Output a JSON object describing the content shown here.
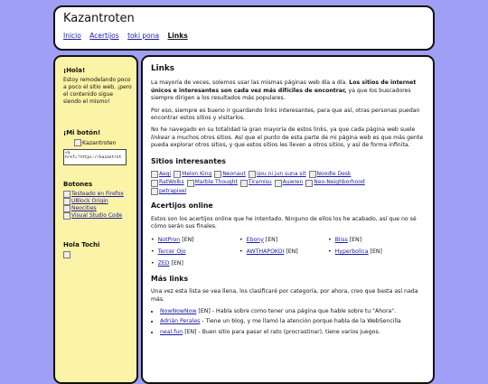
{
  "header": {
    "site_title": "Kazantroten",
    "nav": [
      "Inicio",
      "Acertijos",
      "toki pona",
      "Links"
    ]
  },
  "sidebar": {
    "hola": {
      "title": "¡Hola!",
      "text": "Estoy remodelando poco a poco el sitio web, ¡pero el contenido sigue siendo el mismo!"
    },
    "mi_boton": {
      "title": "¡Mi botón!",
      "img_alt": "Kazantroten",
      "code": "<a\nhref=\"https://kazantrot"
    },
    "botones": {
      "title": "Botones",
      "items": [
        "Testeado en Firefox",
        "UBlock Origin",
        "Neocities",
        "Visual Studio Code"
      ]
    },
    "hola_tochi": {
      "title": "Hola Tochi"
    }
  },
  "main": {
    "title": "Links",
    "intro": [
      "La mayoría de veces, solemos usar las mismas páginas web día a día. ",
      "Los sitios de internet únicos e interesantes son cada vez más difíciles de encontrar,",
      " ya que los buscadores siempre dirigen a los resultados más populares."
    ],
    "p2": "Por eso, siempre es bueno ir guardando links interesantes, para que así, otras personas puedan encontrar estos sitios y visitarlos.",
    "p3_a": "No he navegado en su totalidad la gran mayoría de estos links, ya que cada página web suele ",
    "p3_em": "linkear",
    "p3_b": " a muchos otros sitios. Así que el punto de esta parte de mi página web es que más gente pueda explorar otros sitios, y que estos sitios les lleven a otros sitios, y así de forma infinita.",
    "sitios": {
      "title": "Sitios interesantes",
      "items": [
        "Aegi",
        "Melon King",
        "Neonaut",
        "ijou ni jun suna sit",
        "Noodle Desk",
        "RatWolks",
        "Marble Thought",
        "Tiramisu",
        "Auwren",
        "Neo-Neighborhood",
        "petrapixel"
      ]
    },
    "acertijos": {
      "title": "Acertijos online",
      "text": "Estos son los acertijos online que he intentado. Ninguno de ellos los he acabado, así que no sé cómo serán sus finales.",
      "items": [
        {
          "name": "NotPron",
          "tag": "[EN]"
        },
        {
          "name": "Ebony",
          "tag": "[EN]"
        },
        {
          "name": "Bliss",
          "tag": "[EN]"
        },
        {
          "name": "Tercer Ojo",
          "tag": ""
        },
        {
          "name": "AWTHAPOKOI",
          "tag": "[EN]"
        },
        {
          "name": "Hyperbolica",
          "tag": "[EN]"
        },
        {
          "name": "ZED",
          "tag": "[EN]"
        }
      ]
    },
    "mas_links": {
      "title": "Más links",
      "text": "Una vez esta lista se vea llena, los clasificaré por categoría, por ahora, creo que basta así nada más.",
      "items": [
        {
          "name": "NowNowNow",
          "desc": " [EN] - Habla sobre como tener una página que hable sobre tu \"Ahora\"."
        },
        {
          "name": "Adrián Perales",
          "desc": " - Tiene un blog, y me llamó la atención porque habla de la WebSencilla"
        },
        {
          "name": "neal.fun",
          "desc": " [EN] - Buen sitio para pasar el rato (procrastinar), tiene varios juegos."
        }
      ]
    }
  }
}
